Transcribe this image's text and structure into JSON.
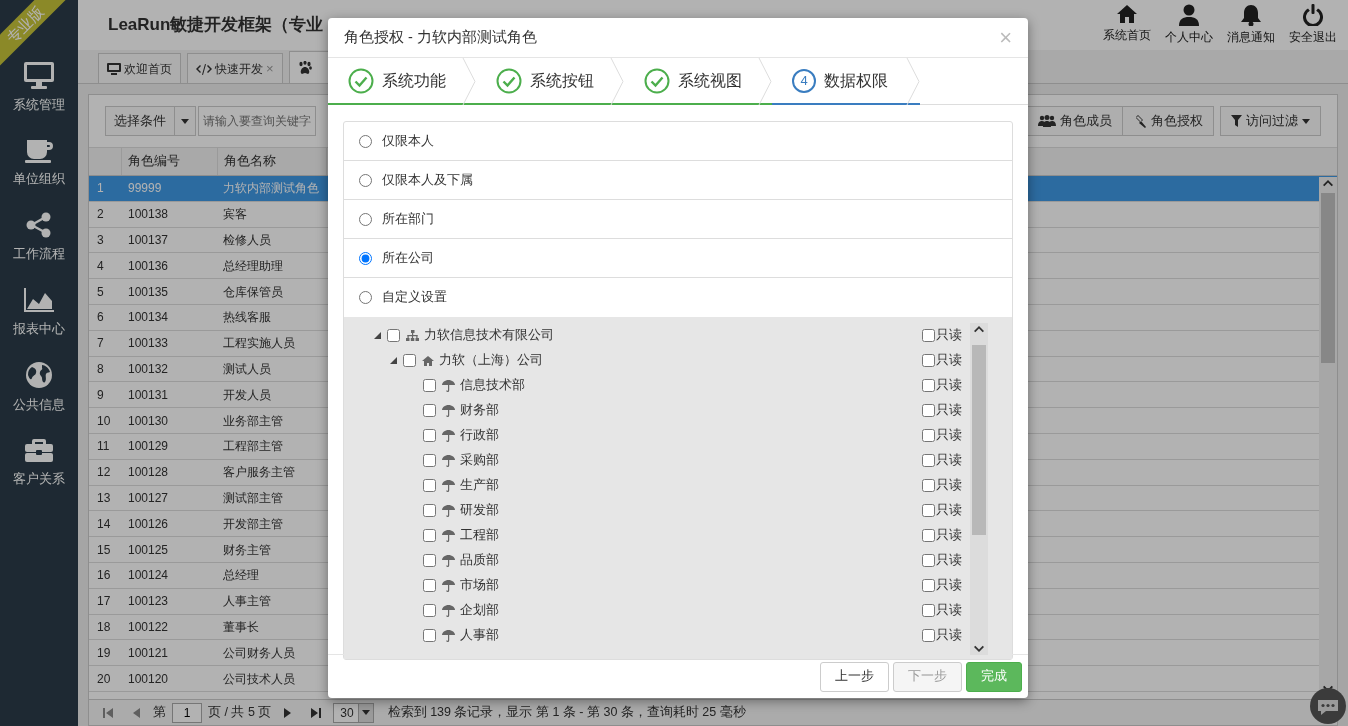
{
  "ribbon": "专业版",
  "sidebar": {
    "items": [
      {
        "label": "系统管理"
      },
      {
        "label": "单位组织"
      },
      {
        "label": "工作流程"
      },
      {
        "label": "报表中心"
      },
      {
        "label": "公共信息"
      },
      {
        "label": "客户关系"
      }
    ]
  },
  "app_title": "LeaRun敏捷开发框架（专业",
  "top_nav": [
    {
      "label": "系统首页"
    },
    {
      "label": "个人中心"
    },
    {
      "label": "消息通知"
    },
    {
      "label": "安全退出"
    }
  ],
  "tabs": [
    {
      "label": "欢迎首页",
      "selected": false
    },
    {
      "label": "快速开发",
      "close": "×",
      "selected": false
    },
    {
      "selected": true
    }
  ],
  "toolbar": {
    "condition_button": "选择条件",
    "search": {
      "placeholder": "请输入要查询关键字"
    },
    "buttons": [
      {
        "label": "角色成员",
        "dropdown": false
      },
      {
        "label": "角色授权",
        "dropdown": false
      },
      {
        "label": "访问过滤",
        "dropdown": true
      }
    ]
  },
  "table": {
    "columns": [
      "角色编号",
      "角色名称"
    ],
    "rows": [
      {
        "index": "1",
        "code": "99999",
        "name": "力软内部测试角色",
        "selected": true
      },
      {
        "index": "2",
        "code": "100138",
        "name": "宾客",
        "selected": false
      },
      {
        "index": "3",
        "code": "100137",
        "name": "检修人员",
        "selected": false
      },
      {
        "index": "4",
        "code": "100136",
        "name": "总经理助理",
        "selected": false
      },
      {
        "index": "5",
        "code": "100135",
        "name": "仓库保管员",
        "selected": false
      },
      {
        "index": "6",
        "code": "100134",
        "name": "热线客服",
        "selected": false
      },
      {
        "index": "7",
        "code": "100133",
        "name": "工程实施人员",
        "selected": false
      },
      {
        "index": "8",
        "code": "100132",
        "name": "测试人员",
        "selected": false
      },
      {
        "index": "9",
        "code": "100131",
        "name": "开发人员",
        "selected": false
      },
      {
        "index": "10",
        "code": "100130",
        "name": "业务部主管",
        "selected": false
      },
      {
        "index": "11",
        "code": "100129",
        "name": "工程部主管",
        "selected": false
      },
      {
        "index": "12",
        "code": "100128",
        "name": "客户服务主管",
        "selected": false
      },
      {
        "index": "13",
        "code": "100127",
        "name": "测试部主管",
        "selected": false
      },
      {
        "index": "14",
        "code": "100126",
        "name": "开发部主管",
        "selected": false
      },
      {
        "index": "15",
        "code": "100125",
        "name": "财务主管",
        "selected": false
      },
      {
        "index": "16",
        "code": "100124",
        "name": "总经理",
        "selected": false
      },
      {
        "index": "17",
        "code": "100123",
        "name": "人事主管",
        "selected": false
      },
      {
        "index": "18",
        "code": "100122",
        "name": "董事长",
        "selected": false
      },
      {
        "index": "19",
        "code": "100121",
        "name": "公司财务人员",
        "selected": false
      },
      {
        "index": "20",
        "code": "100120",
        "name": "公司技术人员",
        "selected": false
      }
    ]
  },
  "pager": {
    "page_prefix": "第",
    "page": "1",
    "page_suffix": "页 / 共 5 页",
    "page_size": "30",
    "summary": "检索到 139 条记录，显示 第 1 条 - 第 30 条，查询耗时 25 毫秒"
  },
  "modal": {
    "title": "角色授权 - 力软内部测试角色",
    "close": "×",
    "steps": [
      {
        "label": "系统功能",
        "done": true,
        "selected": false
      },
      {
        "label": "系统按钮",
        "done": true,
        "selected": false
      },
      {
        "label": "系统视图",
        "done": true,
        "selected": false
      },
      {
        "number": "4",
        "label": "数据权限",
        "done": false,
        "selected": true
      }
    ],
    "options": [
      {
        "label": "仅限本人",
        "selected": false
      },
      {
        "label": "仅限本人及下属",
        "selected": false
      },
      {
        "label": "所在部门",
        "selected": false
      },
      {
        "label": "所在公司",
        "selected": true
      },
      {
        "label": "自定义设置",
        "selected": false
      }
    ],
    "tree": [
      {
        "label": "力软信息技术有限公司",
        "kind": "company",
        "expanded": true,
        "checked": false,
        "readonly_label": "只读",
        "readonly": false,
        "children": [
          {
            "label": "力软（上海）公司",
            "kind": "branch",
            "expanded": true,
            "checked": false,
            "readonly_label": "只读",
            "readonly": false,
            "children": [
              {
                "label": "信息技术部",
                "kind": "department",
                "checked": false,
                "readonly_label": "只读",
                "readonly": false
              },
              {
                "label": "财务部",
                "kind": "department",
                "checked": false,
                "readonly_label": "只读",
                "readonly": false
              },
              {
                "label": "行政部",
                "kind": "department",
                "checked": false,
                "readonly_label": "只读",
                "readonly": false
              },
              {
                "label": "采购部",
                "kind": "department",
                "checked": false,
                "readonly_label": "只读",
                "readonly": false
              },
              {
                "label": "生产部",
                "kind": "department",
                "checked": false,
                "readonly_label": "只读",
                "readonly": false
              },
              {
                "label": "研发部",
                "kind": "department",
                "checked": false,
                "readonly_label": "只读",
                "readonly": false
              },
              {
                "label": "工程部",
                "kind": "department",
                "checked": false,
                "readonly_label": "只读",
                "readonly": false
              },
              {
                "label": "品质部",
                "kind": "department",
                "checked": false,
                "readonly_label": "只读",
                "readonly": false
              },
              {
                "label": "市场部",
                "kind": "department",
                "checked": false,
                "readonly_label": "只读",
                "readonly": false
              },
              {
                "label": "企划部",
                "kind": "department",
                "checked": false,
                "readonly_label": "只读",
                "readonly": false
              },
              {
                "label": "人事部",
                "kind": "department",
                "checked": false,
                "readonly_label": "只读",
                "readonly": false
              }
            ]
          }
        ]
      }
    ],
    "buttons": [
      {
        "label": "上一步",
        "kind": "default",
        "disabled": false
      },
      {
        "label": "下一步",
        "kind": "default",
        "disabled": true
      },
      {
        "label": "完成",
        "kind": "success",
        "disabled": false
      }
    ]
  }
}
